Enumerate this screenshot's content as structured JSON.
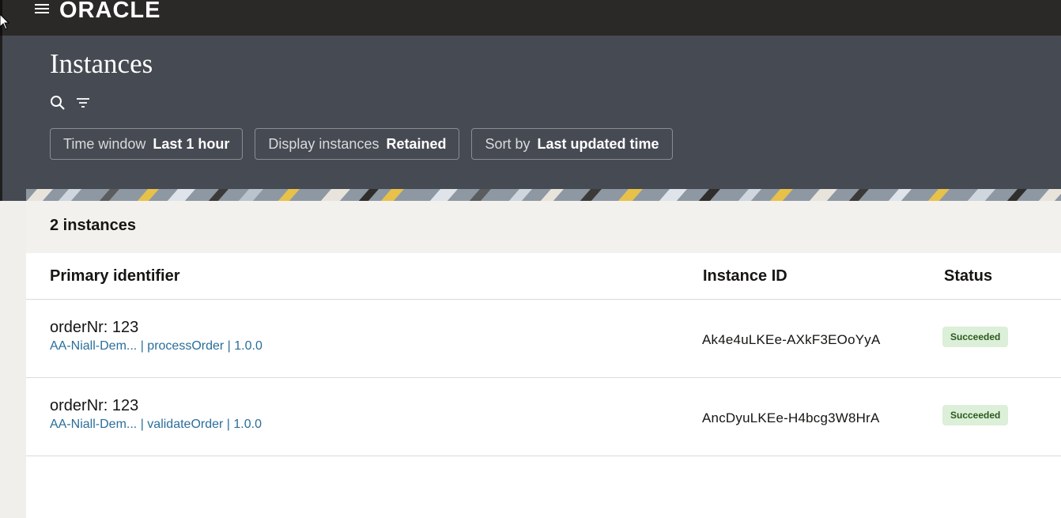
{
  "brand": {
    "logo_text": "ORACLE"
  },
  "header": {
    "title": "Instances",
    "filters": [
      {
        "label": "Time window",
        "value": "Last 1 hour"
      },
      {
        "label": "Display instances",
        "value": "Retained"
      },
      {
        "label": "Sort by",
        "value": "Last updated time"
      }
    ]
  },
  "summary": {
    "count_text": "2 instances"
  },
  "table": {
    "columns": [
      "Primary identifier",
      "Instance ID",
      "Status"
    ],
    "rows": [
      {
        "primary": "orderNr: 123",
        "app": "AA-Niall-Dem...",
        "process": "processOrder",
        "version": "1.0.0",
        "instance_id": "Ak4e4uLKEe-AXkF3EOoYyA",
        "status": "Succeeded"
      },
      {
        "primary": "orderNr: 123",
        "app": "AA-Niall-Dem...",
        "process": "validateOrder",
        "version": "1.0.0",
        "instance_id": "AncDyuLKEe-H4bcg3W8HrA",
        "status": "Succeeded"
      }
    ],
    "separator": "|"
  },
  "colors": {
    "header_bg": "#464a52",
    "topbar_bg": "#2b2927",
    "link": "#2a6e9a",
    "success_bg": "#dcefd8"
  }
}
